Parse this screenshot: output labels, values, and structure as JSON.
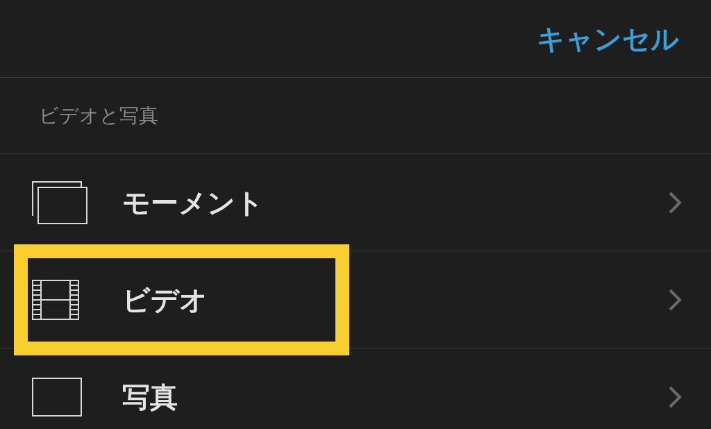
{
  "nav_bar": {
    "cancel": "キャンセル"
  },
  "section": {
    "header": "ビデオと写真",
    "items": [
      {
        "kind": "moments",
        "label": "モーメント",
        "highlighted": false
      },
      {
        "kind": "video",
        "label": "ビデオ",
        "highlighted": true
      },
      {
        "kind": "photo",
        "label": "写真",
        "highlighted": false
      }
    ]
  }
}
